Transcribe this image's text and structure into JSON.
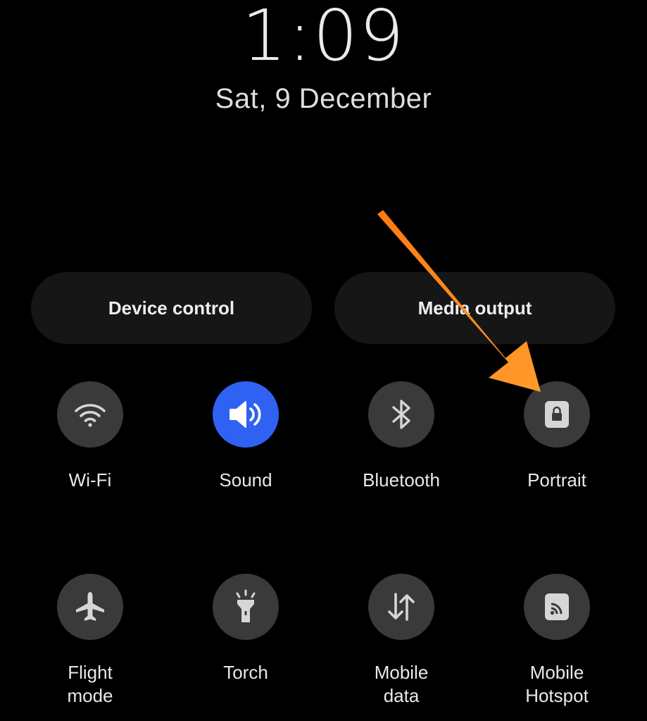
{
  "lockscreen": {
    "time": "1:09",
    "date": "Sat, 9 December"
  },
  "buttons": {
    "device_control": "Device control",
    "media_output": "Media output"
  },
  "tiles_row1": [
    {
      "label": "Wi-Fi",
      "icon": "wifi-icon",
      "active": false
    },
    {
      "label": "Sound",
      "icon": "speaker-icon",
      "active": true
    },
    {
      "label": "Bluetooth",
      "icon": "bluetooth-icon",
      "active": false
    },
    {
      "label": "Portrait",
      "icon": "rotation-lock-icon",
      "active": false
    }
  ],
  "tiles_row2": [
    {
      "label": "Flight\nmode",
      "icon": "airplane-icon",
      "active": false
    },
    {
      "label": "Torch",
      "icon": "flashlight-icon",
      "active": false
    },
    {
      "label": "Mobile\ndata",
      "icon": "data-transfer-icon",
      "active": false
    },
    {
      "label": "Mobile\nHotspot",
      "icon": "hotspot-icon",
      "active": false
    }
  ],
  "colors": {
    "background": "#000000",
    "tile_inactive": "#3a3a3a",
    "tile_active": "#2f62f2",
    "annotation_arrow": "#ff8a1c"
  },
  "annotation": {
    "type": "arrow",
    "points_to": "Portrait"
  }
}
